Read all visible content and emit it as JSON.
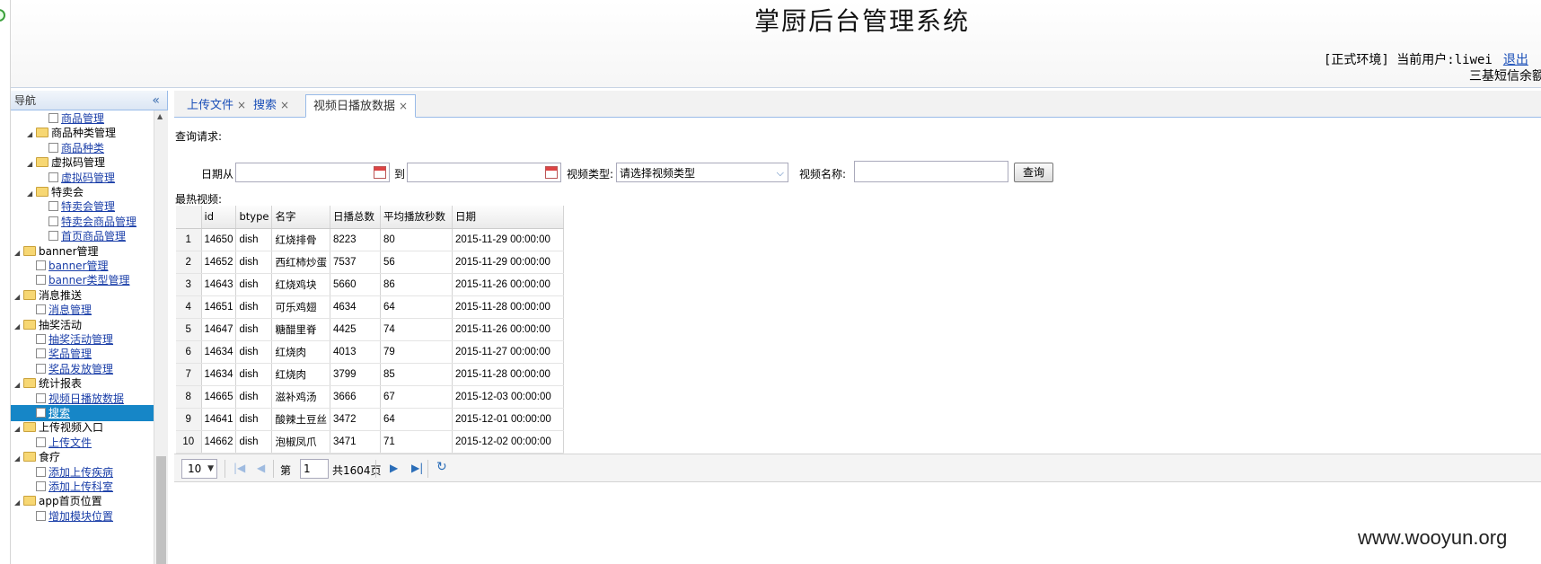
{
  "header": {
    "system_title": "掌厨后台管理系统",
    "user_info": "[正式环境] 当前用户:liwei",
    "logout_label": "退出",
    "sms_balance": "三基短信余额"
  },
  "sidebar": {
    "title": "导航",
    "collapse_icon": "«",
    "items": [
      {
        "label": "商品管理",
        "type": "file",
        "level": 2
      },
      {
        "label": "商品种类管理",
        "type": "folder",
        "level": 1
      },
      {
        "label": "商品种类",
        "type": "file",
        "level": 2
      },
      {
        "label": "虚拟码管理",
        "type": "folder",
        "level": 1
      },
      {
        "label": "虚拟码管理",
        "type": "file",
        "level": 2
      },
      {
        "label": "特卖会",
        "type": "folder",
        "level": 1
      },
      {
        "label": "特卖会管理",
        "type": "file",
        "level": 2
      },
      {
        "label": "特卖会商品管理",
        "type": "file",
        "level": 2
      },
      {
        "label": "首页商品管理",
        "type": "file",
        "level": 2
      },
      {
        "label": "banner管理",
        "type": "folder",
        "level": 0
      },
      {
        "label": "banner管理",
        "type": "file",
        "level": 1
      },
      {
        "label": "banner类型管理",
        "type": "file",
        "level": 1
      },
      {
        "label": "消息推送",
        "type": "folder",
        "level": 0
      },
      {
        "label": "消息管理",
        "type": "file",
        "level": 1
      },
      {
        "label": "抽奖活动",
        "type": "folder",
        "level": 0
      },
      {
        "label": "抽奖活动管理",
        "type": "file",
        "level": 1
      },
      {
        "label": "奖品管理",
        "type": "file",
        "level": 1
      },
      {
        "label": "奖品发放管理",
        "type": "file",
        "level": 1
      },
      {
        "label": "统计报表",
        "type": "folder",
        "level": 0
      },
      {
        "label": "视频日播放数据",
        "type": "file",
        "level": 1
      },
      {
        "label": "搜索",
        "type": "file",
        "level": 1,
        "selected": true
      },
      {
        "label": "上传视频入口",
        "type": "folder",
        "level": 0
      },
      {
        "label": "上传文件",
        "type": "file",
        "level": 1
      },
      {
        "label": "食疗",
        "type": "folder",
        "level": 0
      },
      {
        "label": "添加上传疾病",
        "type": "file",
        "level": 1
      },
      {
        "label": "添加上传科室",
        "type": "file",
        "level": 1
      },
      {
        "label": "app首页位置",
        "type": "folder",
        "level": 0
      },
      {
        "label": "增加模块位置",
        "type": "file",
        "level": 1
      }
    ]
  },
  "tabs": [
    {
      "label": "上传文件",
      "close": "×"
    },
    {
      "label": "搜索",
      "close": "×"
    },
    {
      "label": "视频日播放数据",
      "close": "×",
      "active": true
    }
  ],
  "query": {
    "section_label": "查询请求:",
    "date_from_label": "日期从",
    "to_label": "到",
    "video_type_label": "视频类型:",
    "video_type_value": "请选择视频类型",
    "video_name_label": "视频名称:",
    "search_button": "查询"
  },
  "results": {
    "section_label": "最热视频:",
    "columns": [
      "id",
      "btype",
      "名字",
      "日播总数",
      "平均播放秒数",
      "日期"
    ],
    "rows": [
      [
        "1",
        "14650",
        "dish",
        "红烧排骨",
        "8223",
        "80",
        "2015-11-29 00:00:00"
      ],
      [
        "2",
        "14652",
        "dish",
        "西红柿炒蛋",
        "7537",
        "56",
        "2015-11-29 00:00:00"
      ],
      [
        "3",
        "14643",
        "dish",
        "红烧鸡块",
        "5660",
        "86",
        "2015-11-26 00:00:00"
      ],
      [
        "4",
        "14651",
        "dish",
        "可乐鸡翅",
        "4634",
        "64",
        "2015-11-28 00:00:00"
      ],
      [
        "5",
        "14647",
        "dish",
        "糖醋里脊",
        "4425",
        "74",
        "2015-11-26 00:00:00"
      ],
      [
        "6",
        "14634",
        "dish",
        "红烧肉",
        "4013",
        "79",
        "2015-11-27 00:00:00"
      ],
      [
        "7",
        "14634",
        "dish",
        "红烧肉",
        "3799",
        "85",
        "2015-11-28 00:00:00"
      ],
      [
        "8",
        "14665",
        "dish",
        "滋补鸡汤",
        "3666",
        "67",
        "2015-12-03 00:00:00"
      ],
      [
        "9",
        "14641",
        "dish",
        "酸辣土豆丝",
        "3472",
        "64",
        "2015-12-01 00:00:00"
      ],
      [
        "10",
        "14662",
        "dish",
        "泡椒凤爪",
        "3471",
        "71",
        "2015-12-02 00:00:00"
      ]
    ]
  },
  "pager": {
    "page_size": "10",
    "page_prefix": "第",
    "page_number": "1",
    "total_pages": "共1604页"
  },
  "watermark": "www.wooyun.org"
}
